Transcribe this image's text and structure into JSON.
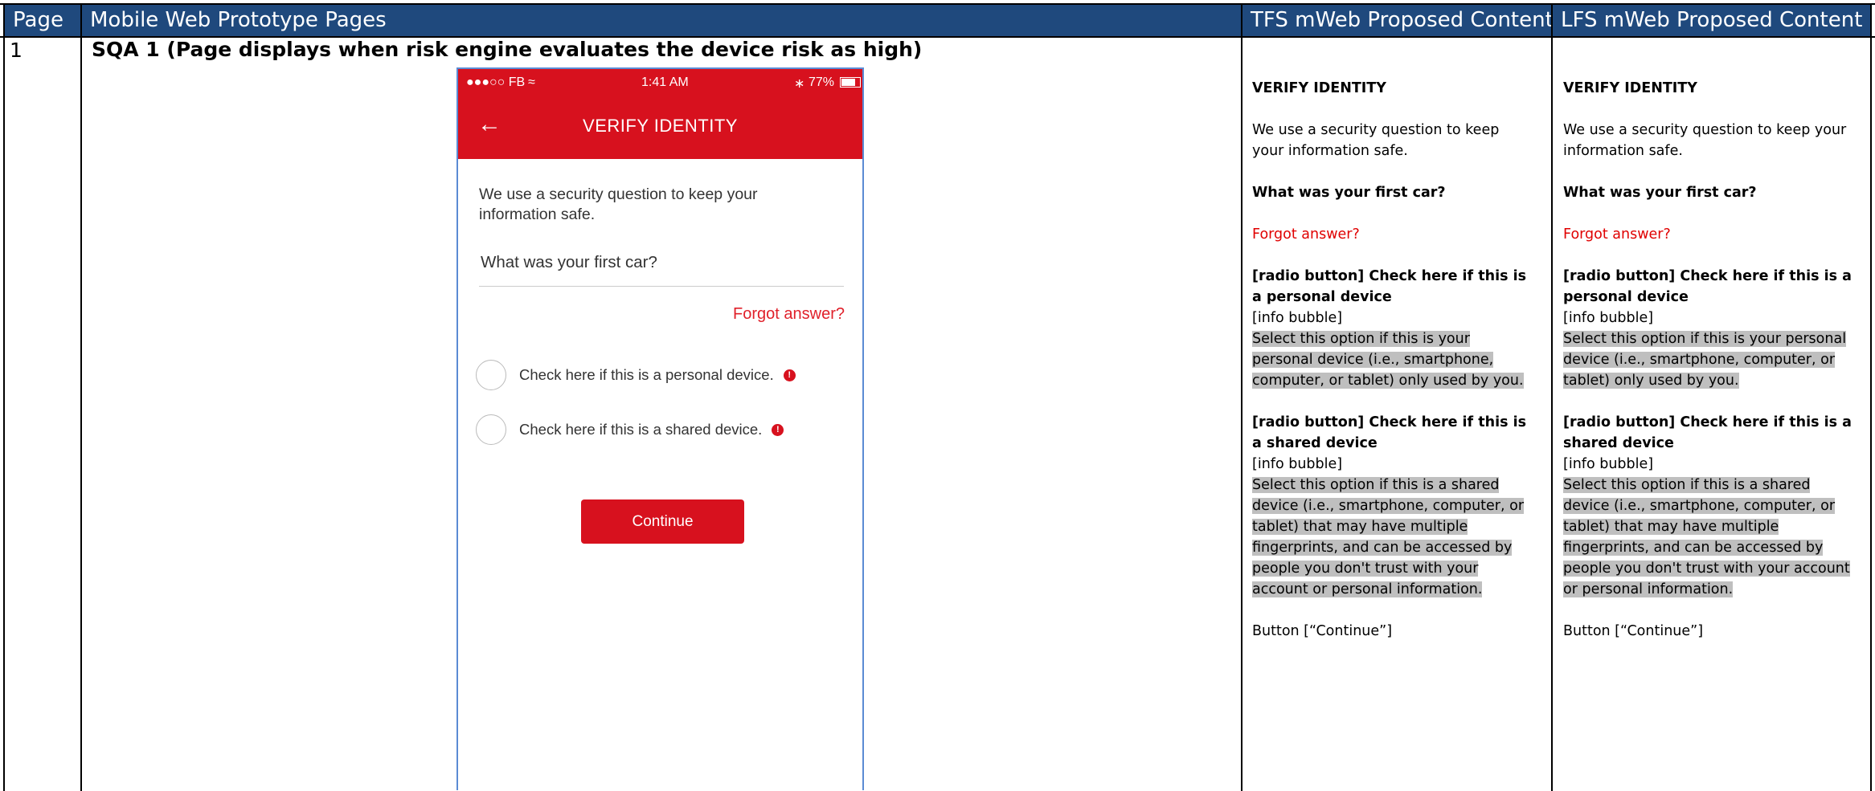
{
  "header": {
    "col_page": "Page",
    "col_prototype": "Mobile Web Prototype Pages",
    "col_tfs": "TFS mWeb Proposed Content",
    "col_lfs": "LFS mWeb Proposed Content"
  },
  "row": {
    "page_number": "1",
    "title": "SQA 1 (Page displays when risk engine evaluates the device risk as high)"
  },
  "phone": {
    "status_left": "●●●○○ FB",
    "time": "1:41 AM",
    "battery": "77%",
    "back_icon": "back-arrow-icon",
    "title": "VERIFY IDENTITY",
    "intro": "We use a security question to keep your information safe.",
    "question": "What was your first car?",
    "forgot": "Forgot answer?",
    "personal_label": "Check here if this is a personal device.",
    "shared_label": "Check here if this is a shared device.",
    "continue": "Continue",
    "accent_color": "#d7111e"
  },
  "tfs": {
    "heading": "VERIFY IDENTITY",
    "intro": "We use a security question to keep your information safe.",
    "question": "What was your first car?",
    "forgot": "Forgot answer?",
    "personal_radio": "[radio button] Check here if this is a personal device",
    "personal_bubble": "[info bubble]",
    "personal_info": "Select this option if this is your personal device (i.e., smartphone, computer, or tablet) only used by you.",
    "shared_radio": "[radio button] Check here if this is a shared device",
    "shared_bubble": "[info bubble]",
    "shared_info": "Select this option if this is a shared device (i.e., smartphone, computer, or tablet) that may have multiple fingerprints, and can be accessed by people you don't trust with your account or personal information.",
    "button": "Button [“Continue”]"
  },
  "lfs": {
    "heading": "VERIFY IDENTITY",
    "intro": "We use a security question to keep your information safe.",
    "question": "What was your first car?",
    "forgot": "Forgot answer?",
    "personal_radio": "[radio button] Check here if this is a personal device",
    "personal_bubble": "[info bubble]",
    "personal_info": "Select this option if this is your personal device (i.e., smartphone, computer, or tablet) only used by you.",
    "shared_radio": "[radio button] Check here if this is a shared device",
    "shared_bubble": "[info bubble]",
    "shared_info": "Select this option if this is a shared device (i.e., smartphone, computer, or tablet) that may have multiple fingerprints, and can be accessed by people you don't trust with your account or personal information.",
    "button": "Button [“Continue”]"
  }
}
